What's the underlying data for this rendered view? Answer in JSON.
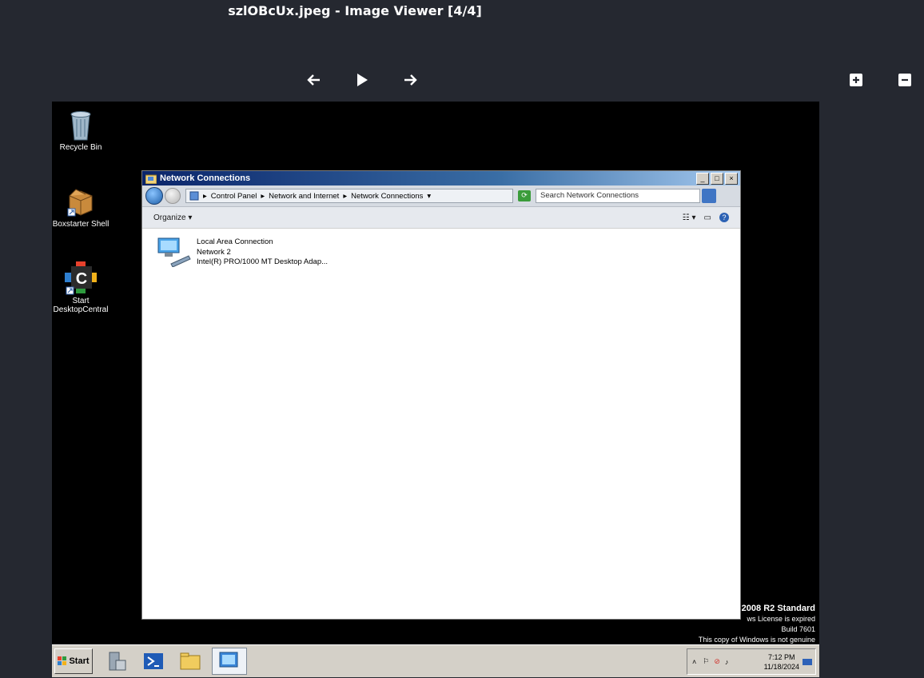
{
  "viewer": {
    "title": "szlOBcUx.jpeg - Image Viewer [4/4]"
  },
  "desktop": {
    "icons": [
      {
        "label": "Recycle Bin",
        "icon": "recycle-bin-icon"
      },
      {
        "label": "Boxstarter Shell",
        "icon": "package-box-icon"
      },
      {
        "label": "Start DesktopCentral",
        "icon": "desktop-central-icon"
      }
    ],
    "watermark": {
      "edition": "2008 R2 Standard",
      "license": "ws License is expired",
      "build": "Build 7601",
      "genuine": "This copy of Windows is not genuine"
    }
  },
  "window": {
    "title": "Network Connections",
    "breadcrumb": [
      "Control Panel",
      "Network and Internet",
      "Network Connections"
    ],
    "search_placeholder": "Search Network Connections",
    "organize_label": "Organize",
    "connection": {
      "name": "Local Area Connection",
      "network": "Network  2",
      "adapter": "Intel(R) PRO/1000 MT Desktop Adap..."
    }
  },
  "taskbar": {
    "start_label": "Start",
    "time": "7:12 PM",
    "date": "11/18/2024"
  }
}
